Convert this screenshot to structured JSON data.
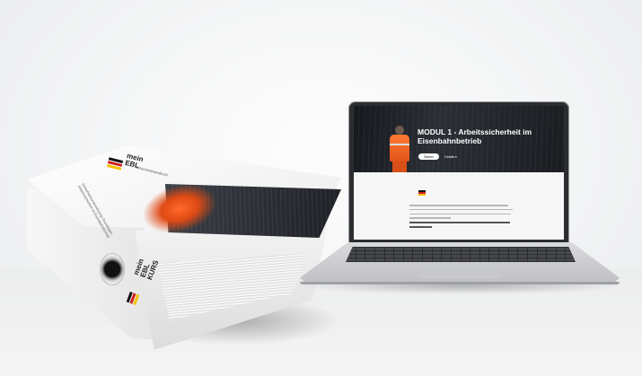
{
  "binder": {
    "brand_line1": "mein",
    "brand_line2": "EBL",
    "brand_line3": "KURS",
    "flag_colors": [
      "#111111",
      "#d21f1f",
      "#f2c200"
    ],
    "subtitle": "Sicherheitshandbuch",
    "spine_text": "Sicherheitsunterweisung Grundlagen Arbeitssicherheit im Eisenbahnbetrieb"
  },
  "laptop": {
    "hero_title": "MODUL 1 - Arbeitssicherheit im Eisenbahnbetrieb",
    "primary_button": "Starten",
    "secondary_button": "Details",
    "secondary_icon": "chevron-down-icon",
    "accent_color": "#e2531a"
  }
}
